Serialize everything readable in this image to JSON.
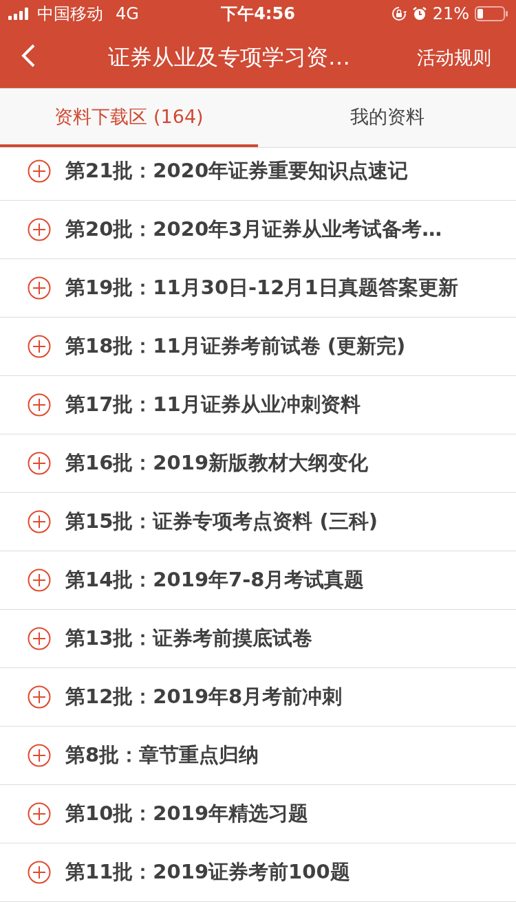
{
  "status_bar": {
    "carrier": "中国移动",
    "network": "4G",
    "time": "下午4:56",
    "battery_percent": "21%"
  },
  "nav_bar": {
    "title": "证券从业及专项学习资…",
    "action": "活动规则"
  },
  "tabs": [
    {
      "label": "资料下载区 (164)",
      "selected": true
    },
    {
      "label": "我的资料",
      "selected": false
    }
  ],
  "items": [
    {
      "title": "第21批：2020年证券重要知识点速记"
    },
    {
      "title": "第20批：2020年3月证券从业考试备考…"
    },
    {
      "title": "第19批：11月30日-12月1日真题答案更新"
    },
    {
      "title": "第18批：11月证券考前试卷 (更新完)"
    },
    {
      "title": "第17批：11月证券从业冲刺资料"
    },
    {
      "title": "第16批：2019新版教材大纲变化"
    },
    {
      "title": "第15批：证券专项考点资料 (三科)"
    },
    {
      "title": "第14批：2019年7-8月考试真题"
    },
    {
      "title": "第13批：证券考前摸底试卷"
    },
    {
      "title": "第12批：2019年8月考前冲刺"
    },
    {
      "title": "第8批：章节重点归纳"
    },
    {
      "title": "第10批：2019年精选习题"
    },
    {
      "title": "第11批：2019证券考前100题"
    }
  ]
}
